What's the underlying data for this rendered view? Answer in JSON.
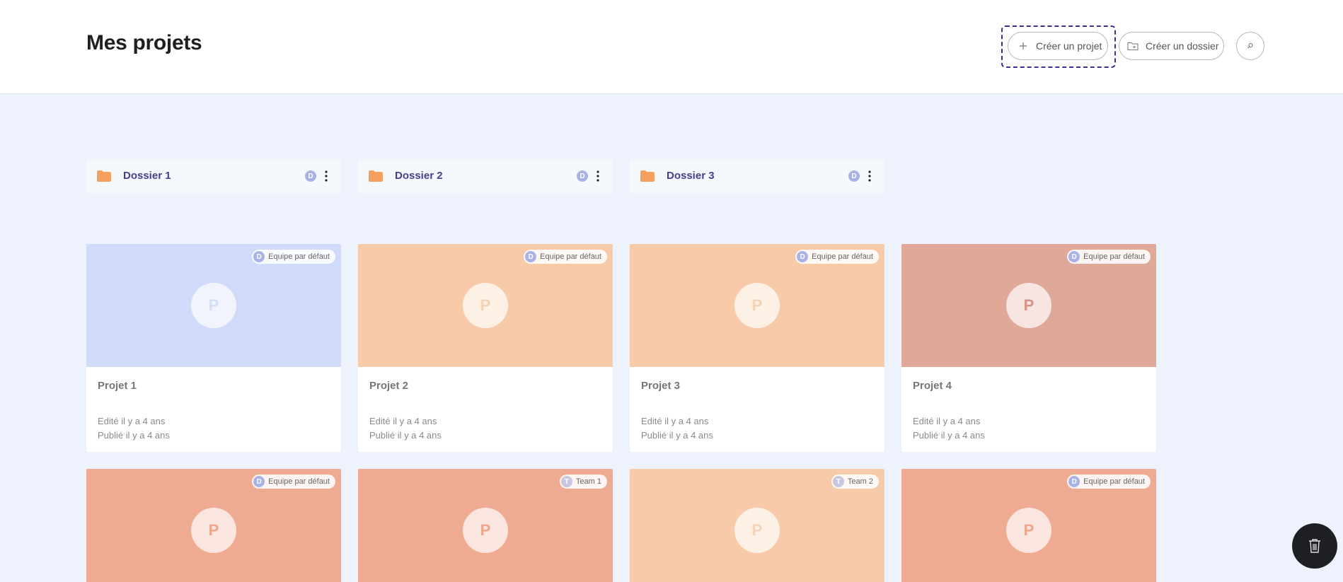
{
  "header": {
    "title": "Mes projets",
    "create_project_label": "Créer un projet",
    "create_folder_label": "Créer un dossier"
  },
  "folders": [
    {
      "name": "Dossier 1",
      "badge": "D"
    },
    {
      "name": "Dossier 2",
      "badge": "D"
    },
    {
      "name": "Dossier 3",
      "badge": "D"
    }
  ],
  "projects": [
    {
      "name": "Projet 1",
      "team": "Equipe par défaut",
      "team_initial": "D",
      "avatar": "P",
      "color": "#cfdbf8",
      "avatar_color": "#d3def8",
      "edited": "Edité il y a 4 ans",
      "published": "Publié il y a 4 ans"
    },
    {
      "name": "Projet 2",
      "team": "Equipe par défaut",
      "team_initial": "D",
      "avatar": "P",
      "color": "#f7cba9",
      "avatar_color": "#f7d2b4",
      "edited": "Edité il y a 4 ans",
      "published": "Publié il y a 4 ans"
    },
    {
      "name": "Projet 3",
      "team": "Equipe par défaut",
      "team_initial": "D",
      "avatar": "P",
      "color": "#f7cba9",
      "avatar_color": "#f7d2b4",
      "edited": "Edité il y a 4 ans",
      "published": "Publié il y a 4 ans"
    },
    {
      "name": "Projet 4",
      "team": "Equipe par défaut",
      "team_initial": "D",
      "avatar": "P",
      "color": "#e0a899",
      "avatar_color": "#d99283",
      "edited": "Edité il y a 4 ans",
      "published": "Publié il y a 4 ans"
    },
    {
      "name": "",
      "team": "Equipe par défaut",
      "team_initial": "D",
      "avatar": "P",
      "color": "#efaa92",
      "avatar_color": "#eea58c",
      "edited": "",
      "published": ""
    },
    {
      "name": "",
      "team": "Team 1",
      "team_initial": "T",
      "avatar": "P",
      "color": "#efaa92",
      "avatar_color": "#eea58c",
      "edited": "",
      "published": ""
    },
    {
      "name": "",
      "team": "Team 2",
      "team_initial": "T",
      "avatar": "P",
      "color": "#f7cba9",
      "avatar_color": "#f7d2b4",
      "edited": "",
      "published": ""
    },
    {
      "name": "",
      "team": "Equipe par défaut",
      "team_initial": "D",
      "avatar": "P",
      "color": "#efaa92",
      "avatar_color": "#eea58c",
      "edited": "",
      "published": ""
    }
  ],
  "icons": {
    "plus": "plus-icon",
    "folder_add": "folder-add-icon",
    "search": "search-icon",
    "folder": "folder-icon",
    "more": "more-vertical-icon",
    "trash": "trash-icon"
  },
  "colors": {
    "accent": "#4a3d8f",
    "folder": "#f5a05f",
    "background": "#edf2fc"
  }
}
